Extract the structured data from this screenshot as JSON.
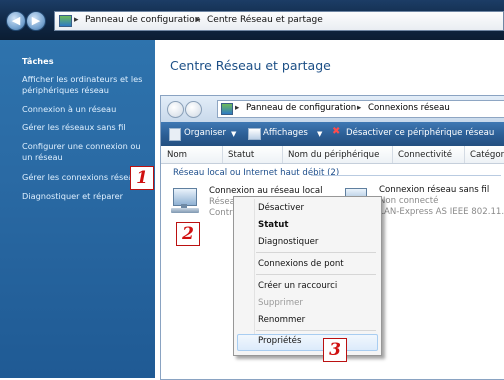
{
  "breadcrumb": {
    "item1": "Panneau de configuration",
    "separator": "▸",
    "item2": "Centre Réseau et partage"
  },
  "sidebar": {
    "heading": "Tâches",
    "items": [
      {
        "label": "Afficher les ordinateurs et les périphériques réseau"
      },
      {
        "label": "Connexion à un réseau"
      },
      {
        "label": "Gérer les réseaux sans fil"
      },
      {
        "label": "Configurer une connexion ou un réseau"
      },
      {
        "label": "Gérer les connexions réseau"
      },
      {
        "label": "Diagnostiquer et réparer"
      }
    ]
  },
  "main": {
    "title": "Centre Réseau et partage"
  },
  "inner": {
    "address": {
      "item1": "Panneau de configuration",
      "item2": "Connexions réseau"
    },
    "toolbar": {
      "organize": "Organiser",
      "views": "Affichages",
      "disable": "Désactiver ce périphérique réseau"
    },
    "columns": [
      "Nom",
      "Statut",
      "Nom du périphérique",
      "Connectivité",
      "Catégorie"
    ],
    "group": "Réseau local ou Internet haut débit (2)",
    "connections": [
      {
        "name": "Connexion au réseau local",
        "line2": "Résea",
        "line3": "Contr"
      },
      {
        "name": "Connexion réseau sans fil",
        "status": "Non connecté",
        "device": "LAN-Express AS IEEE 802.11..."
      }
    ]
  },
  "context_menu": {
    "items": [
      "Désactiver",
      "Statut",
      "Diagnostiquer",
      "Connexions de pont",
      "Créer un raccourci",
      "Supprimer",
      "Renommer",
      "Propriétés"
    ]
  },
  "markers": [
    "1",
    "2",
    "3"
  ],
  "colors": {
    "accent": "#2a6aa4",
    "marker_red": "#d01010"
  }
}
